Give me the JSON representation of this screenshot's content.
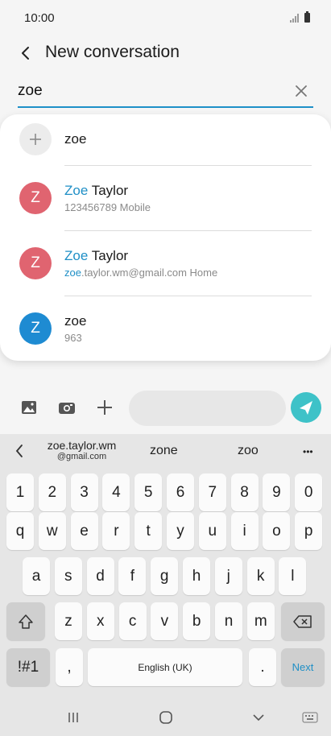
{
  "status_bar": {
    "time": "10:00"
  },
  "header": {
    "title": "New conversation"
  },
  "search": {
    "value": "zoe"
  },
  "suggestions": [
    {
      "type": "new",
      "label": "zoe"
    },
    {
      "name_hl": "Zoe",
      "name_rest": " Taylor",
      "detail_hl": "",
      "detail_rest": "123456789  Mobile",
      "initial": "Z",
      "avatar_color": "#e06470"
    },
    {
      "name_hl": "Zoe",
      "name_rest": " Taylor",
      "detail_hl": "zoe",
      "detail_rest": ".taylor.wm@gmail.com  Home",
      "initial": "Z",
      "avatar_color": "#e06470"
    },
    {
      "name_hl": "zoe",
      "name_rest": "",
      "detail_hl": "",
      "detail_rest": "963",
      "initial": "Z",
      "avatar_color": "#1e8bd2"
    }
  ],
  "keyboard": {
    "suggestions": {
      "first_line1": "zoe.taylor.wm",
      "first_line2": "@gmail.com",
      "second": "zone",
      "third": "zoo",
      "more": "•••"
    },
    "row_numbers": [
      "1",
      "2",
      "3",
      "4",
      "5",
      "6",
      "7",
      "8",
      "9",
      "0"
    ],
    "row1": [
      "q",
      "w",
      "e",
      "r",
      "t",
      "y",
      "u",
      "i",
      "o",
      "p"
    ],
    "row2": [
      "a",
      "s",
      "d",
      "f",
      "g",
      "h",
      "j",
      "k",
      "l"
    ],
    "row3": [
      "z",
      "x",
      "c",
      "v",
      "b",
      "n",
      "m"
    ],
    "symbols_label": "!#1",
    "comma_label": ",",
    "space_label": "English (UK)",
    "period_label": ".",
    "next_label": "Next"
  },
  "colors": {
    "accent": "#1f8fc6",
    "send": "#3ec2c8"
  }
}
